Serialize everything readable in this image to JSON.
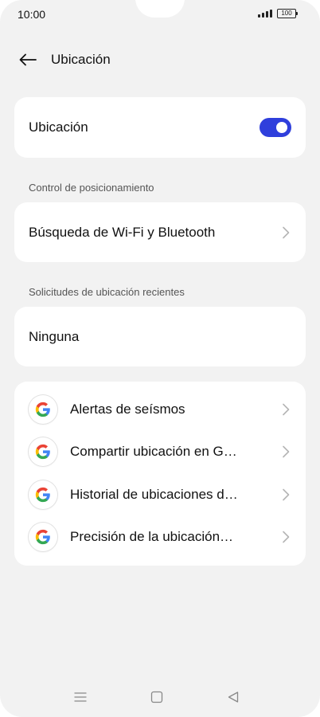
{
  "status_bar": {
    "time": "10:00",
    "battery": "100"
  },
  "header": {
    "title": "Ubicación"
  },
  "location_card": {
    "label": "Ubicación",
    "toggle_on": true
  },
  "positioning": {
    "section_label": "Control de posicionamiento",
    "item_label": "Búsqueda de Wi-Fi y Bluetooth"
  },
  "recent_requests": {
    "section_label": "Solicitudes de ubicación recientes",
    "value": "Ninguna"
  },
  "services": [
    {
      "label": "Alertas de seísmos",
      "icon": "google-icon"
    },
    {
      "label": "Compartir ubicación en G…",
      "icon": "google-icon"
    },
    {
      "label": "Historial de ubicaciones d…",
      "icon": "google-icon"
    },
    {
      "label": "Precisión de la ubicación…",
      "icon": "google-icon"
    }
  ],
  "colors": {
    "accent": "#2f3fdc",
    "background": "#f2f2f2",
    "card": "#ffffff"
  },
  "navbar": {
    "icons": [
      "menu-icon",
      "home-icon",
      "back-triangle-icon"
    ]
  }
}
